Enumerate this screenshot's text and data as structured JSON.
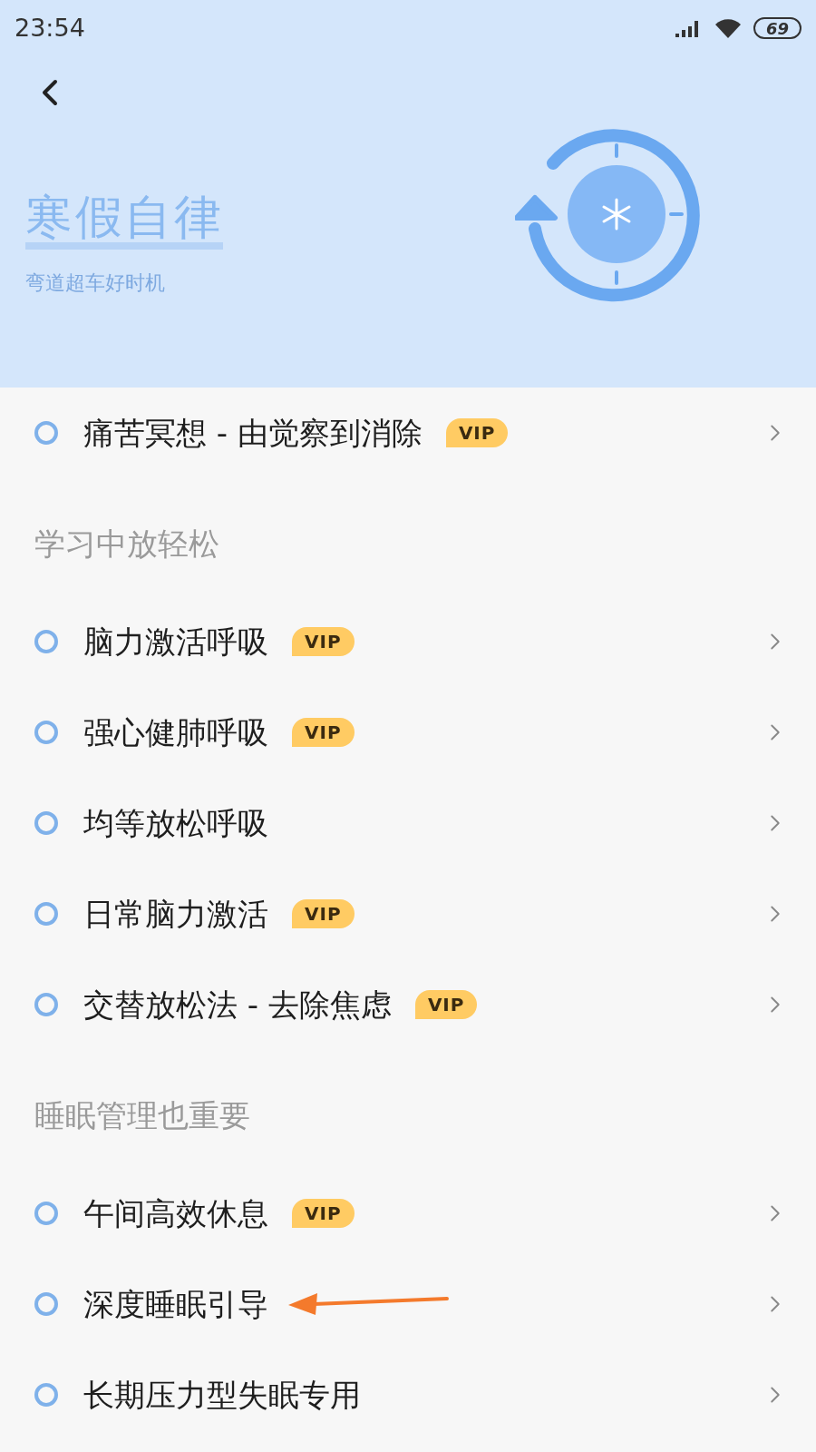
{
  "status_bar": {
    "time": "23:54",
    "battery": "69"
  },
  "header": {
    "title": "寒假自律",
    "subtitle": "弯道超车好时机"
  },
  "sections": [
    {
      "items": [
        {
          "label": "痛苦冥想 - 由觉察到消除",
          "badge": "VIP",
          "pointed": false
        }
      ]
    },
    {
      "heading": "学习中放轻松",
      "items": [
        {
          "label": "脑力激活呼吸",
          "badge": "VIP",
          "pointed": false
        },
        {
          "label": "强心健肺呼吸",
          "badge": "VIP",
          "pointed": false
        },
        {
          "label": "均等放松呼吸",
          "pointed": false
        },
        {
          "label": "日常脑力激活",
          "badge": "VIP",
          "pointed": false
        },
        {
          "label": "交替放松法 - 去除焦虑",
          "badge": "VIP",
          "pointed": false
        }
      ]
    },
    {
      "heading": "睡眠管理也重要",
      "items": [
        {
          "label": "午间高效休息",
          "badge": "VIP",
          "pointed": false
        },
        {
          "label": "深度睡眠引导",
          "pointed": true
        },
        {
          "label": "长期压力型失眠专用",
          "pointed": false
        }
      ]
    }
  ]
}
